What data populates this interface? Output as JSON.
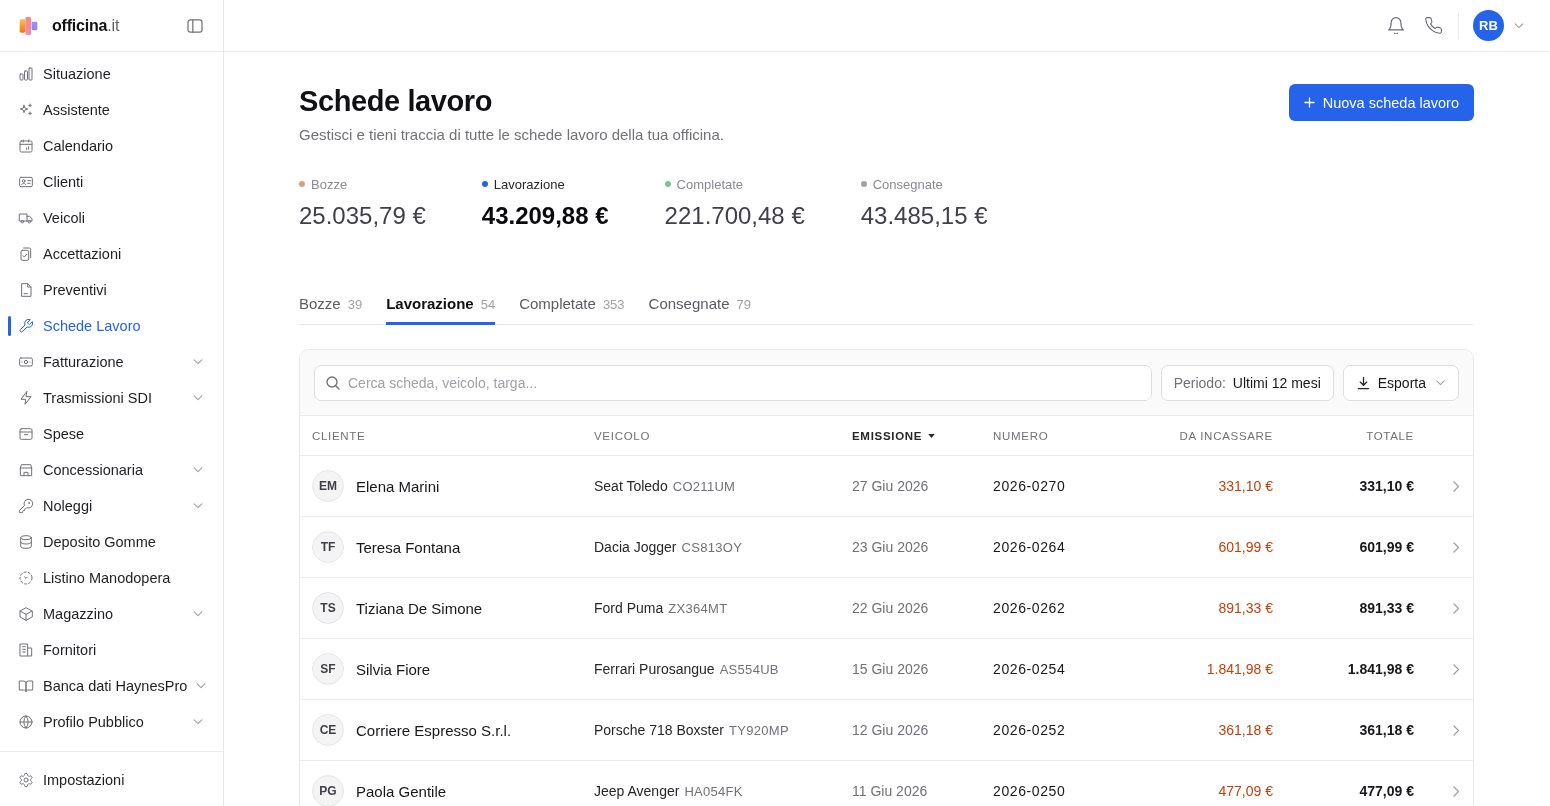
{
  "sidebar": {
    "brand": "**officina**.it",
    "items": [
      {
        "label": "Situazione",
        "selected": false,
        "has_submenu": false
      },
      {
        "label": "Assistente",
        "selected": false,
        "has_submenu": false
      },
      {
        "label": "Calendario",
        "selected": false,
        "has_submenu": false
      },
      {
        "label": "Clienti",
        "selected": false,
        "has_submenu": false
      },
      {
        "label": "Veicoli",
        "selected": false,
        "has_submenu": false
      },
      {
        "label": "Accettazioni",
        "selected": false,
        "has_submenu": false
      },
      {
        "label": "Preventivi",
        "selected": false,
        "has_submenu": false
      },
      {
        "label": "Schede Lavoro",
        "selected": true,
        "has_submenu": false
      },
      {
        "label": "Fatturazione",
        "selected": false,
        "has_submenu": true
      },
      {
        "label": "Trasmissioni SDI",
        "selected": false,
        "has_submenu": true
      },
      {
        "label": "Spese",
        "selected": false,
        "has_submenu": false
      },
      {
        "label": "Concessionaria",
        "selected": false,
        "has_submenu": true
      },
      {
        "label": "Noleggi",
        "selected": false,
        "has_submenu": true
      },
      {
        "label": "Deposito Gomme",
        "selected": false,
        "has_submenu": false
      },
      {
        "label": "Listino Manodopera",
        "selected": false,
        "has_submenu": false
      },
      {
        "label": "Magazzino",
        "selected": false,
        "has_submenu": true
      },
      {
        "label": "Fornitori",
        "selected": false,
        "has_submenu": false
      },
      {
        "label": "Banca dati HaynesPro",
        "selected": false,
        "has_submenu": true
      },
      {
        "label": "Profilo Pubblico",
        "selected": false,
        "has_submenu": true
      }
    ],
    "footer_items": [
      {
        "label": "Impostazioni",
        "selected": false,
        "has_submenu": false
      }
    ]
  },
  "topbar": {
    "user_initials": "RB"
  },
  "header": {
    "title": "Schede lavoro",
    "subtitle": "Gestisci e tieni traccia di tutte le schede lavoro della tua officina.",
    "action_button": "Nuova scheda lavoro"
  },
  "stats": [
    {
      "label": "Bozze",
      "value": "25.035,79 €",
      "color": "#d9a07a",
      "active": false
    },
    {
      "label": "Lavorazione",
      "value": "43.209,88 €",
      "color": "#2563eb",
      "active": true
    },
    {
      "label": "Completate",
      "value": "221.700,48 €",
      "color": "#7cc392",
      "active": false
    },
    {
      "label": "Consegnate",
      "value": "43.485,15 €",
      "color": "#a1a1aa",
      "active": false
    }
  ],
  "tabs": [
    {
      "label": "Bozze",
      "count": "39",
      "selected": false
    },
    {
      "label": "Lavorazione",
      "count": "54",
      "selected": true
    },
    {
      "label": "Completate",
      "count": "353",
      "selected": false
    },
    {
      "label": "Consegnate",
      "count": "79",
      "selected": false
    }
  ],
  "toolbar": {
    "search": {
      "placeholder": "Cerca scheda, veicolo, targa..."
    },
    "period": {
      "label": "Periodo:",
      "value": "Ultimi 12 mesi"
    },
    "export_button": "Esporta"
  },
  "table": {
    "columns": [
      {
        "label": "CLIENTE",
        "sorted": false
      },
      {
        "label": "VEICOLO",
        "sorted": false
      },
      {
        "label": "EMISSIONE",
        "sorted": true
      },
      {
        "label": "NUMERO",
        "sorted": false
      },
      {
        "label": "DA INCASSARE",
        "sorted": false
      },
      {
        "label": "TOTALE",
        "sorted": false
      }
    ],
    "rows": [
      {
        "initials": "EM",
        "client": "Elena Marini",
        "vehicle": "Seat Toledo",
        "plate": "CO211UM",
        "date": "27 Giu 2026",
        "number": "2026-0270",
        "due": "331,10 €",
        "total": "331,10 €"
      },
      {
        "initials": "TF",
        "client": "Teresa Fontana",
        "vehicle": "Dacia Jogger",
        "plate": "CS813OY",
        "date": "23 Giu 2026",
        "number": "2026-0264",
        "due": "601,99 €",
        "total": "601,99 €"
      },
      {
        "initials": "TS",
        "client": "Tiziana De Simone",
        "vehicle": "Ford Puma",
        "plate": "ZX364MT",
        "date": "22 Giu 2026",
        "number": "2026-0262",
        "due": "891,33 €",
        "total": "891,33 €"
      },
      {
        "initials": "SF",
        "client": "Silvia Fiore",
        "vehicle": "Ferrari Purosangue",
        "plate": "AS554UB",
        "date": "15 Giu 2026",
        "number": "2026-0254",
        "due": "1.841,98 €",
        "total": "1.841,98 €"
      },
      {
        "initials": "CE",
        "client": "Corriere Espresso S.r.l.",
        "vehicle": "Porsche 718 Boxster",
        "plate": "TY920MP",
        "date": "12 Giu 2026",
        "number": "2026-0252",
        "due": "361,18 €",
        "total": "361,18 €"
      },
      {
        "initials": "PG",
        "client": "Paola Gentile",
        "vehicle": "Jeep Avenger",
        "plate": "HA054FK",
        "date": "11 Giu 2026",
        "number": "2026-0250",
        "due": "477,09 €",
        "total": "477,09 €"
      }
    ]
  }
}
